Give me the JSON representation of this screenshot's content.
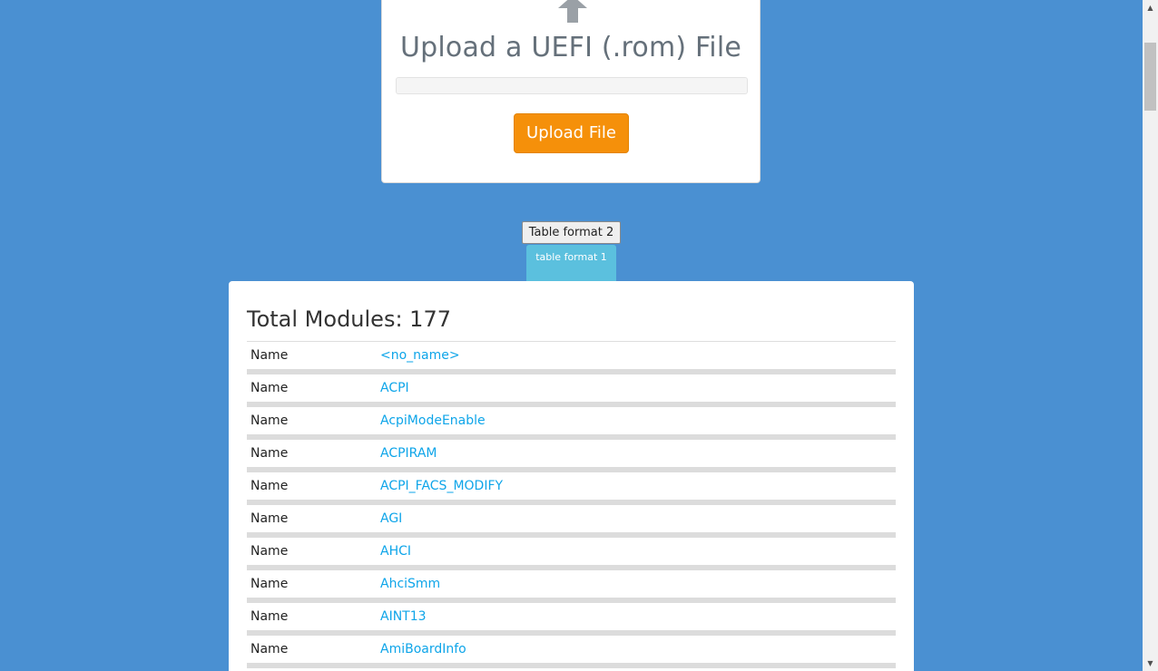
{
  "upload": {
    "title": "Upload a UEFI (.rom) File",
    "button_label": "Upload File"
  },
  "format_toggle": {
    "format2_label": "Table format 2",
    "format1_label": "table format 1"
  },
  "modules": {
    "total_label": "Total Modules: 177",
    "rows": [
      {
        "key": "Name",
        "value": "<no_name>"
      },
      {
        "key": "Name",
        "value": "ACPI"
      },
      {
        "key": "Name",
        "value": "AcpiModeEnable"
      },
      {
        "key": "Name",
        "value": "ACPIRAM"
      },
      {
        "key": "Name",
        "value": "ACPI_FACS_MODIFY"
      },
      {
        "key": "Name",
        "value": "AGI"
      },
      {
        "key": "Name",
        "value": "AHCI"
      },
      {
        "key": "Name",
        "value": "AhciSmm"
      },
      {
        "key": "Name",
        "value": "AINT13"
      },
      {
        "key": "Name",
        "value": "AmiBoardInfo"
      }
    ]
  },
  "colors": {
    "background": "#4a90d2",
    "upload_button": "#f5900a",
    "active_tab": "#5bc0de",
    "link": "#0ea5e9"
  },
  "icons": {
    "upload": "upload-arrow-icon",
    "scroll_up": "scroll-up-arrow-icon",
    "scroll_down": "scroll-down-arrow-icon"
  }
}
